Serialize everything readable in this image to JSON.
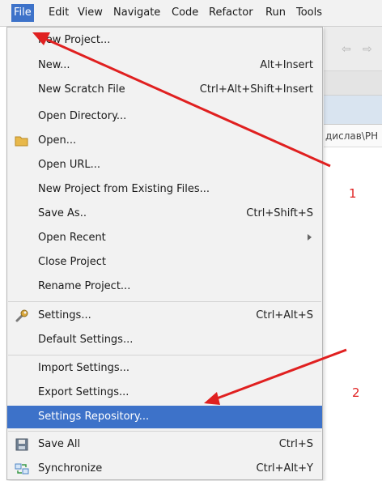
{
  "menubar": {
    "items": [
      "File",
      "Edit",
      "View",
      "Navigate",
      "Code",
      "Refactor",
      "Run",
      "Tools"
    ]
  },
  "path_fragment": "дислав\\PH",
  "menu": {
    "items": [
      {
        "label": "New Project...",
        "shortcut": ""
      },
      {
        "label": "New...",
        "shortcut": "Alt+Insert"
      },
      {
        "label": "New Scratch File",
        "shortcut": "Ctrl+Alt+Shift+Insert"
      },
      {
        "label": "Open Directory...",
        "shortcut": ""
      },
      {
        "label": "Open...",
        "shortcut": "",
        "icon": "folder-icon"
      },
      {
        "label": "Open URL...",
        "shortcut": ""
      },
      {
        "label": "New Project from Existing Files...",
        "shortcut": ""
      },
      {
        "label": "Save As..",
        "shortcut": "Ctrl+Shift+S"
      },
      {
        "label": "Open Recent",
        "shortcut": "",
        "submenu": true
      },
      {
        "label": "Close Project",
        "shortcut": ""
      },
      {
        "label": "Rename Project...",
        "shortcut": ""
      },
      {
        "label": "Settings...",
        "shortcut": "Ctrl+Alt+S",
        "icon": "wrench-icon"
      },
      {
        "label": "Default Settings...",
        "shortcut": ""
      },
      {
        "label": "Import Settings...",
        "shortcut": ""
      },
      {
        "label": "Export Settings...",
        "shortcut": ""
      },
      {
        "label": "Settings Repository...",
        "shortcut": "",
        "selected": true
      },
      {
        "label": "Save All",
        "shortcut": "Ctrl+S",
        "icon": "save-icon"
      },
      {
        "label": "Synchronize",
        "shortcut": "Ctrl+Alt+Y",
        "icon": "sync-icon"
      }
    ]
  },
  "annotations": {
    "label_1": "1",
    "label_2": "2",
    "arrow_color": "#e02020"
  },
  "colors": {
    "accent": "#3d72c9",
    "menu_bg": "#f2f2f2"
  }
}
